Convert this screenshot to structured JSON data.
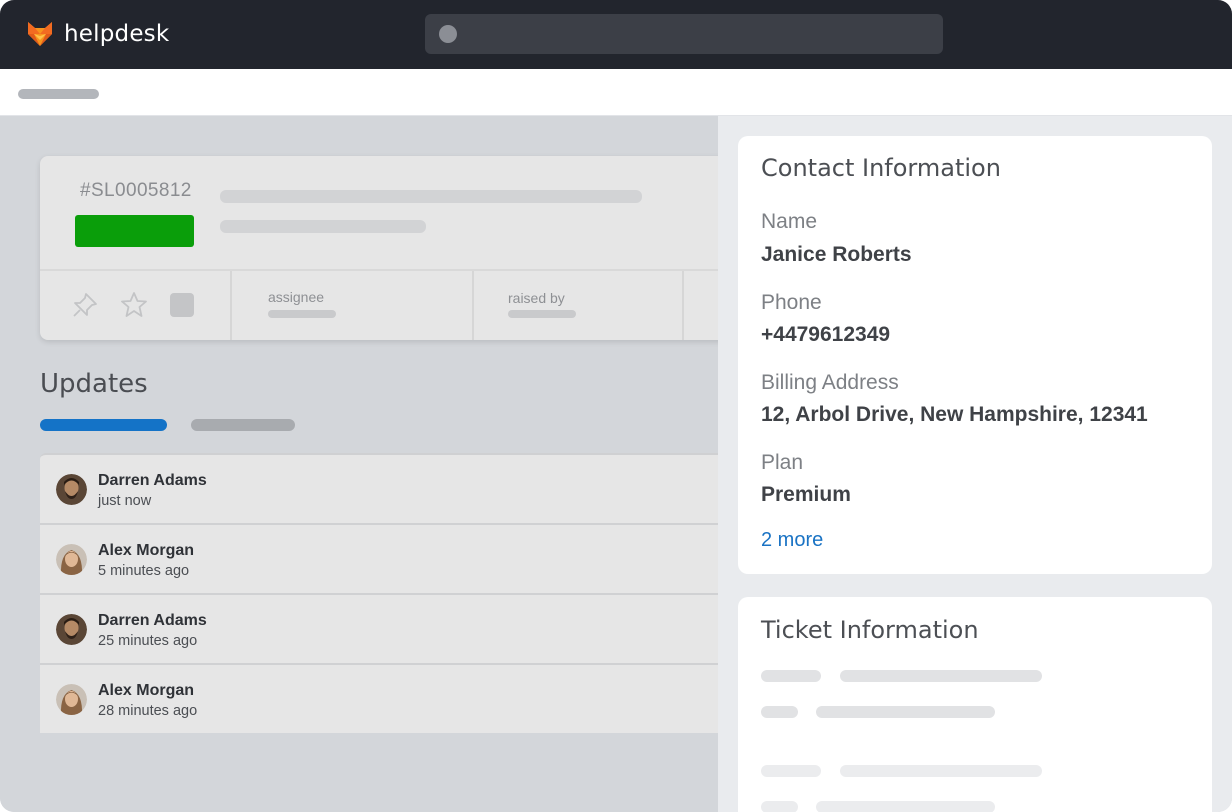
{
  "app": {
    "name": "helpdesk",
    "logo_icon": "fox-logo-icon",
    "search_icon": "search-dot-icon"
  },
  "ticket": {
    "id": "#SL0005812",
    "status_color": "#0a9e0a",
    "actions": [
      "pin-icon",
      "star-icon",
      "square-icon"
    ],
    "meta_labels": [
      "assignee",
      "raised by"
    ]
  },
  "updates": {
    "title": "Updates",
    "items": [
      {
        "name": "Darren Adams",
        "time": "just now"
      },
      {
        "name": "Alex Morgan",
        "time": "5 minutes ago"
      },
      {
        "name": "Darren Adams",
        "time": "25 minutes ago"
      },
      {
        "name": "Alex Morgan",
        "time": "28 minutes ago"
      }
    ]
  },
  "contact": {
    "title": "Contact Information",
    "name_label": "Name",
    "name_value": "Janice Roberts",
    "phone_label": "Phone",
    "phone_value": "+4479612349",
    "address_label": "Billing Address",
    "address_value": "12, Arbol Drive, New Hampshire, 12341",
    "plan_label": "Plan",
    "plan_value": "Premium",
    "more_link": "2 more"
  },
  "ticket_info": {
    "title": "Ticket Information"
  },
  "colors": {
    "accent": "#1473c7",
    "topbar": "#22252d",
    "status_green": "#0a9e0a",
    "link": "#1a73c4"
  }
}
